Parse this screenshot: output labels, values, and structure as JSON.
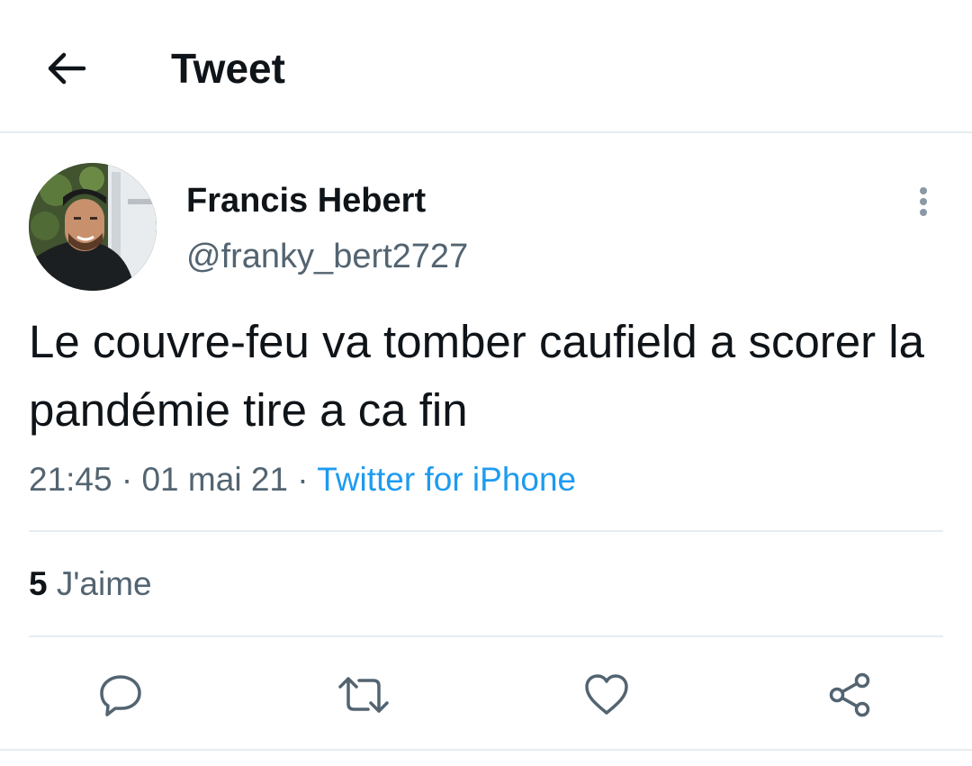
{
  "header": {
    "back_icon": "arrow-left-icon",
    "title": "Tweet"
  },
  "tweet": {
    "author": {
      "name": "Francis Hebert",
      "handle": "@franky_bert2727",
      "avatar_icon": "user-avatar-photo"
    },
    "more_icon": "more-vertical-icon",
    "text": "Le couvre-feu va tomber caufield a scorer la pandémie tire a ca fin",
    "time": "21:45",
    "separator": "·",
    "date": "01 mai 21",
    "source": "Twitter for iPhone"
  },
  "stats": {
    "likes_count": "5",
    "likes_label": "J'aime"
  },
  "actions": {
    "reply_icon": "reply-icon",
    "retweet_icon": "retweet-icon",
    "like_icon": "heart-icon",
    "share_icon": "share-icon"
  },
  "colors": {
    "text_primary": "#0f1419",
    "text_secondary": "#536471",
    "link": "#1d9bf0",
    "divider": "#e6ecf0"
  }
}
